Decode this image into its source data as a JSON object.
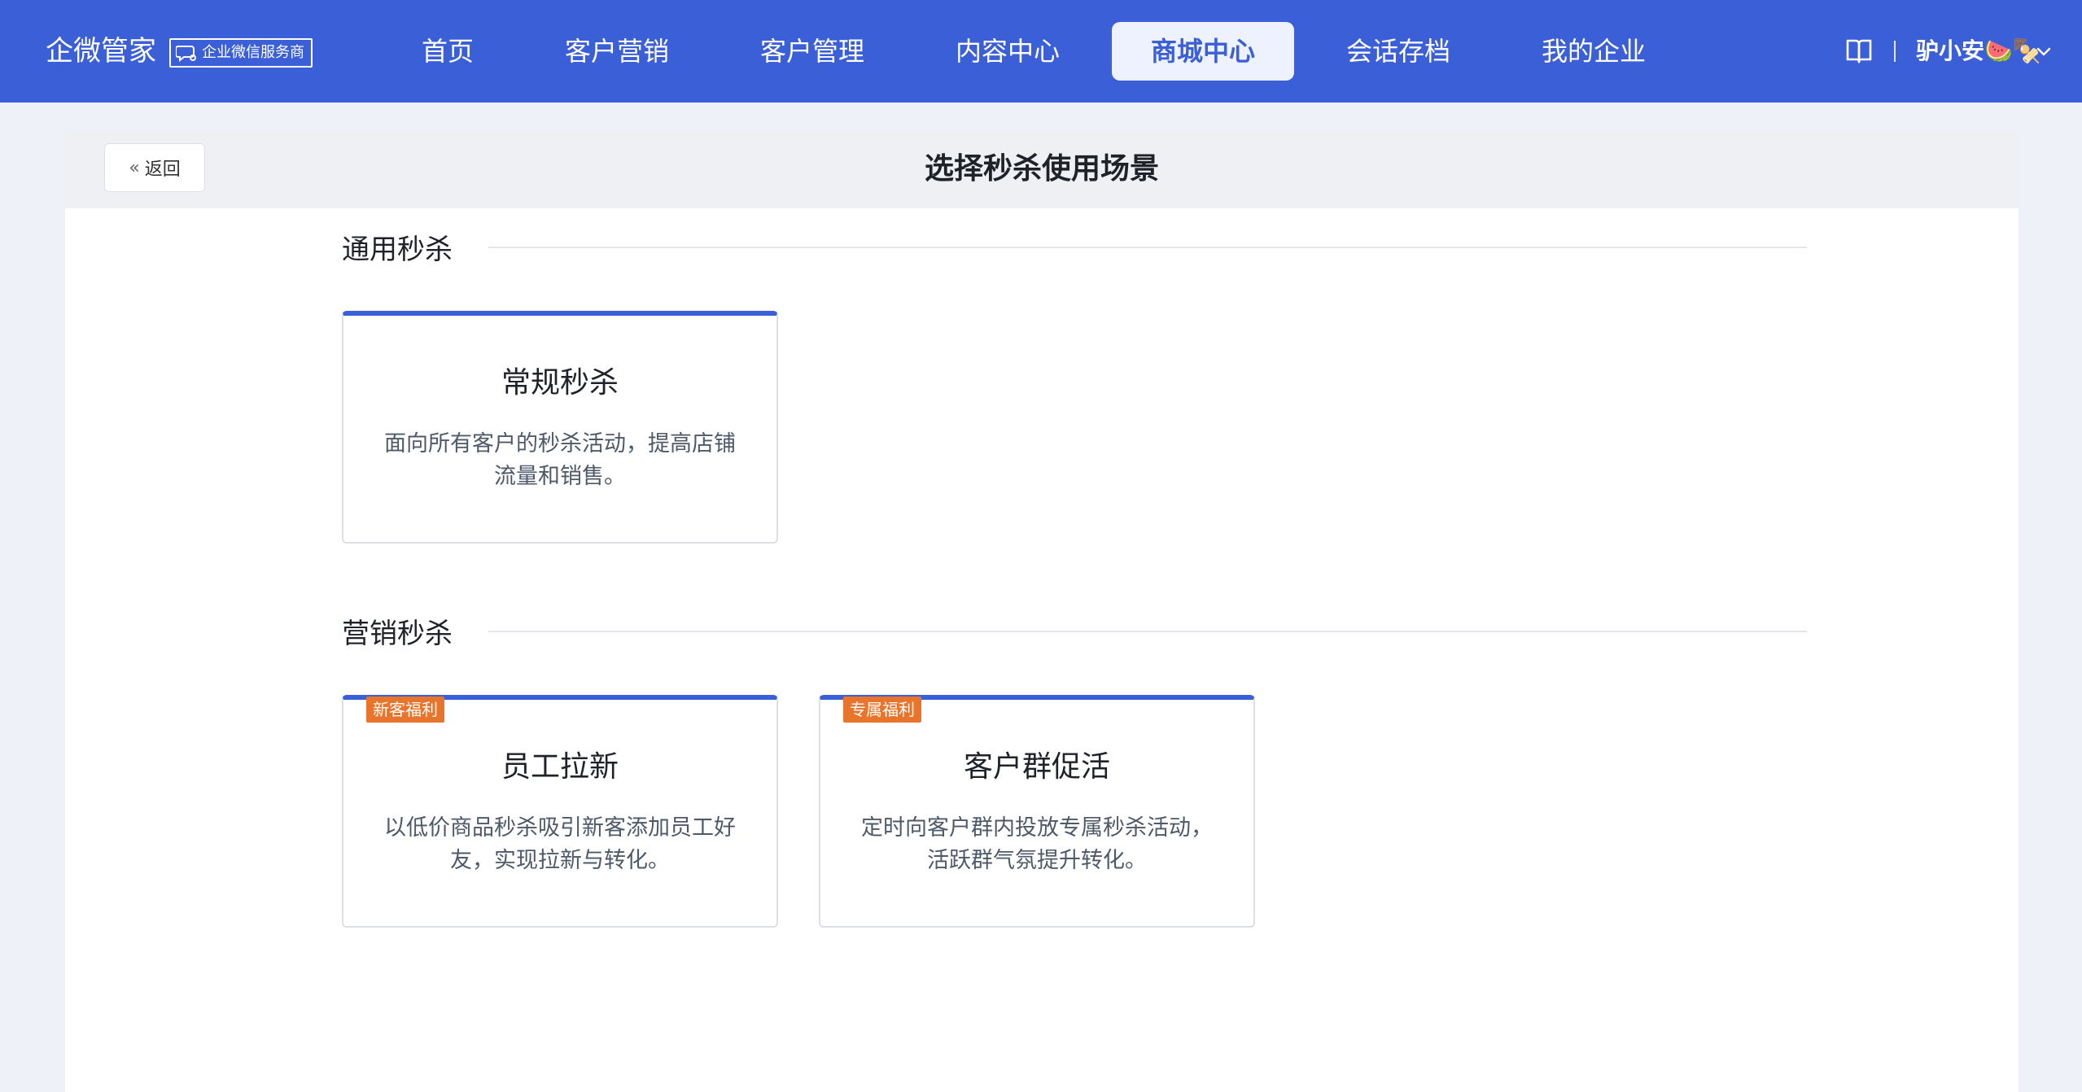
{
  "header": {
    "brand": "企微管家",
    "brand_tag": "企业微信服务商",
    "nav": [
      "首页",
      "客户营销",
      "客户管理",
      "内容中心",
      "商城中心",
      "会话存档",
      "我的企业"
    ],
    "active_nav": "商城中心",
    "user_name": "驴小安🍉🍢",
    "icons": {
      "help": "book-icon",
      "chat": "chat-bubble-icon",
      "dropdown": "chevron-down-icon"
    }
  },
  "page": {
    "back_label": "返回",
    "title": "选择秒杀使用场景"
  },
  "sections": [
    {
      "title": "通用秒杀",
      "cards": [
        {
          "title": "常规秒杀",
          "desc": "面向所有客户的秒杀活动，提高店铺流量和销售。",
          "badge": ""
        }
      ]
    },
    {
      "title": "营销秒杀",
      "cards": [
        {
          "title": "员工拉新",
          "desc": "以低价商品秒杀吸引新客添加员工好友，实现拉新与转化。",
          "badge": "新客福利"
        },
        {
          "title": "客户群促活",
          "desc": "定时向客户群内投放专属秒杀活动，活跃群气氛提升转化。",
          "badge": "专属福利"
        }
      ]
    }
  ],
  "colors": {
    "primary": "#3b5fd6",
    "badge": "#e9742b",
    "bg": "#eef1f8"
  }
}
